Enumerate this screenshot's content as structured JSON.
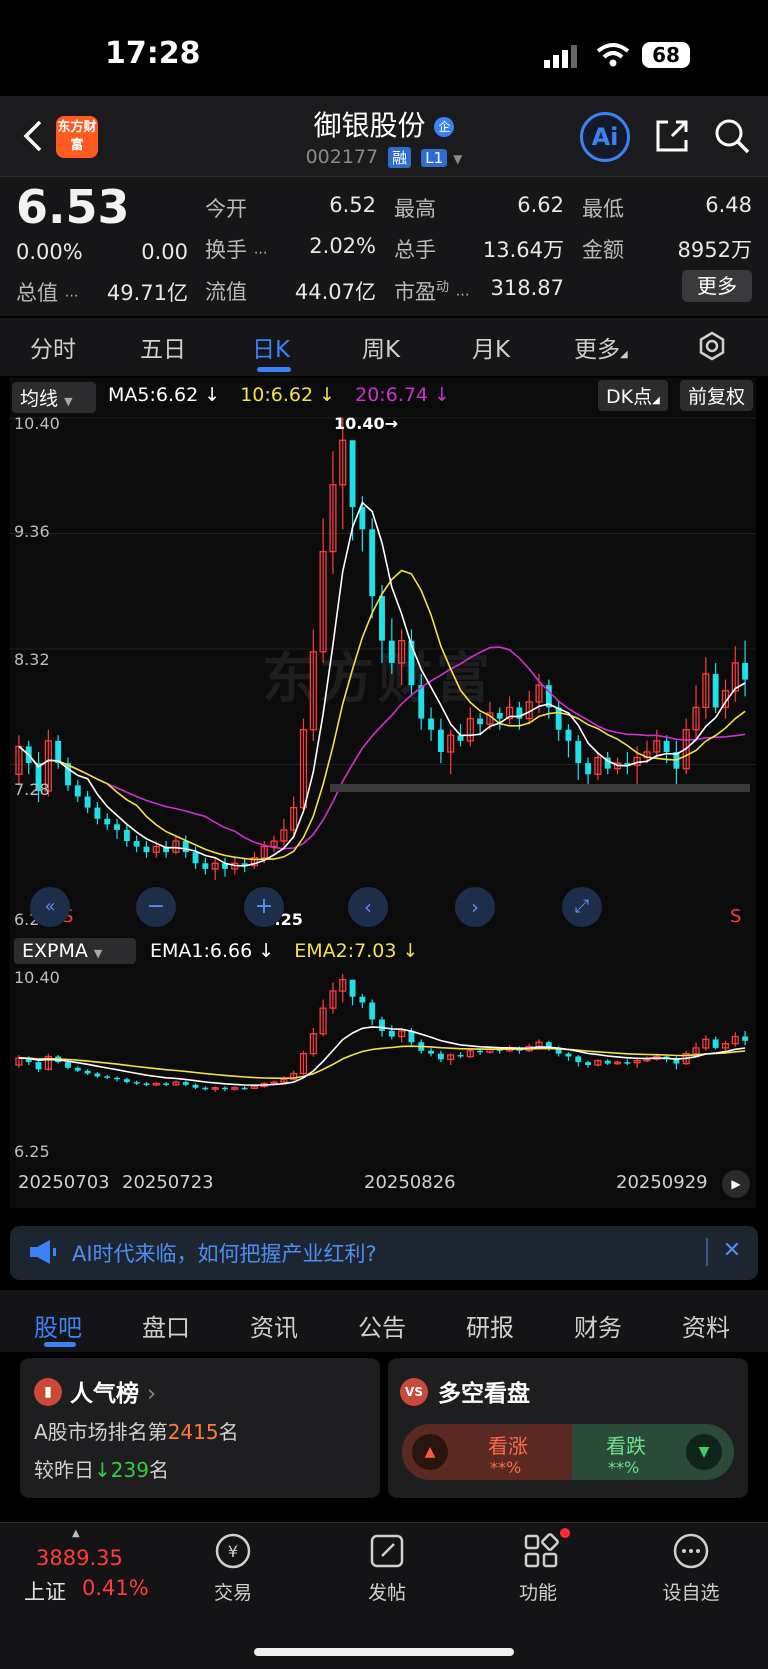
{
  "status_bar": {
    "time": "17:28",
    "battery": "68"
  },
  "header": {
    "logo_text": "东方财富",
    "stock_name": "御银股份",
    "enterprise_badge": "企",
    "stock_code": "002177",
    "tag_margin": "融",
    "tag_level": "L1",
    "ai_label": "Ai"
  },
  "quote": {
    "price": "6.53",
    "change_pct": "0.00%",
    "change_amt": "0.00",
    "market_cap_label": "总值",
    "market_cap": "49.71亿",
    "open_label": "今开",
    "open": "6.52",
    "high_label": "最高",
    "high": "6.62",
    "low_label": "最低",
    "low": "6.48",
    "turnover_label": "换手",
    "turnover": "2.02%",
    "volume_label": "总手",
    "volume": "13.64万",
    "amount_label": "金额",
    "amount": "8952万",
    "float_cap_label": "流值",
    "float_cap": "44.07亿",
    "pe_label": "市盈",
    "pe_sup": "动",
    "pe": "318.87",
    "more": "更多"
  },
  "period_tabs": [
    {
      "label": "分时"
    },
    {
      "label": "五日"
    },
    {
      "label": "日K",
      "active": true
    },
    {
      "label": "周K"
    },
    {
      "label": "月K"
    },
    {
      "label": "更多"
    }
  ],
  "chart": {
    "indicator_select": "均线",
    "ma5": "MA5:6.62",
    "ma10": "10:6.62",
    "ma20": "20:6.74",
    "dk_button": "DK点",
    "adjust_button": "前复权",
    "y_labels": [
      "10.40",
      "9.36",
      "8.32",
      "7.28",
      "6.25"
    ],
    "peak_label": "10.40",
    "low_label": "6.25",
    "s_marker": "S",
    "watermark": "东方财富",
    "sub_indicator_select": "EXPMA",
    "ema1": "EMA1:6.66",
    "ema2": "EMA2:7.03",
    "sub_y_top": "10.40",
    "sub_y_bottom": "6.25",
    "dates": [
      "20250703",
      "20250723",
      "20250826",
      "20250929"
    ],
    "colors": {
      "up": "#ff3b3b",
      "down": "#1fe0e8",
      "ma5": "#ffffff",
      "ma10": "#f2e14a",
      "ma20": "#d12fd1"
    }
  },
  "chart_data": {
    "type": "candlestick",
    "ylim": [
      6.25,
      10.4
    ],
    "annotations": {
      "max": 10.4,
      "min": 6.25
    },
    "x_ticks": [
      "20250703",
      "20250723",
      "20250826",
      "20250929"
    ],
    "candles": [
      [
        7.2,
        7.45,
        7.55,
        7.1
      ],
      [
        7.45,
        7.3,
        7.5,
        7.2
      ],
      [
        7.3,
        7.05,
        7.4,
        6.95
      ],
      [
        7.05,
        7.5,
        7.6,
        7.0
      ],
      [
        7.5,
        7.3,
        7.55,
        7.25
      ],
      [
        7.3,
        7.1,
        7.35,
        7.05
      ],
      [
        7.1,
        7.0,
        7.15,
        6.95
      ],
      [
        7.0,
        6.9,
        7.05,
        6.85
      ],
      [
        6.9,
        6.8,
        6.95,
        6.75
      ],
      [
        6.8,
        6.75,
        6.85,
        6.7
      ],
      [
        6.75,
        6.7,
        6.8,
        6.62
      ],
      [
        6.7,
        6.6,
        6.75,
        6.55
      ],
      [
        6.6,
        6.55,
        6.65,
        6.5
      ],
      [
        6.55,
        6.5,
        6.6,
        6.45
      ],
      [
        6.5,
        6.55,
        6.6,
        6.45
      ],
      [
        6.55,
        6.5,
        6.6,
        6.45
      ],
      [
        6.5,
        6.6,
        6.65,
        6.48
      ],
      [
        6.6,
        6.5,
        6.65,
        6.45
      ],
      [
        6.5,
        6.4,
        6.55,
        6.35
      ],
      [
        6.4,
        6.35,
        6.45,
        6.3
      ],
      [
        6.35,
        6.4,
        6.45,
        6.25
      ],
      [
        6.4,
        6.35,
        6.45,
        6.28
      ],
      [
        6.35,
        6.4,
        6.45,
        6.3
      ],
      [
        6.4,
        6.38,
        6.45,
        6.32
      ],
      [
        6.38,
        6.45,
        6.5,
        6.35
      ],
      [
        6.45,
        6.55,
        6.6,
        6.4
      ],
      [
        6.55,
        6.6,
        6.65,
        6.5
      ],
      [
        6.6,
        6.7,
        6.8,
        6.55
      ],
      [
        6.7,
        6.9,
        7.0,
        6.65
      ],
      [
        6.9,
        7.6,
        7.7,
        6.85
      ],
      [
        7.6,
        8.3,
        8.5,
        7.5
      ],
      [
        8.3,
        9.2,
        9.5,
        8.2
      ],
      [
        9.2,
        9.8,
        10.1,
        9.0
      ],
      [
        9.8,
        10.2,
        10.4,
        9.4
      ],
      [
        10.2,
        9.6,
        10.0,
        9.3
      ],
      [
        9.6,
        9.4,
        9.7,
        9.2
      ],
      [
        9.4,
        8.8,
        9.5,
        8.6
      ],
      [
        8.8,
        8.4,
        8.9,
        8.2
      ],
      [
        8.4,
        8.2,
        8.6,
        8.1
      ],
      [
        8.2,
        8.4,
        8.5,
        8.0
      ],
      [
        8.4,
        8.0,
        8.5,
        7.9
      ],
      [
        8.0,
        7.7,
        8.1,
        7.6
      ],
      [
        7.7,
        7.6,
        7.8,
        7.5
      ],
      [
        7.6,
        7.4,
        7.7,
        7.3
      ],
      [
        7.4,
        7.55,
        7.6,
        7.2
      ],
      [
        7.55,
        7.5,
        7.65,
        7.45
      ],
      [
        7.5,
        7.7,
        7.8,
        7.45
      ],
      [
        7.7,
        7.65,
        7.75,
        7.55
      ],
      [
        7.65,
        7.75,
        7.85,
        7.6
      ],
      [
        7.75,
        7.7,
        7.8,
        7.6
      ],
      [
        7.7,
        7.8,
        7.9,
        7.65
      ],
      [
        7.8,
        7.7,
        7.85,
        7.6
      ],
      [
        7.7,
        7.85,
        7.95,
        7.65
      ],
      [
        7.85,
        8.0,
        8.1,
        7.75
      ],
      [
        8.0,
        7.8,
        8.05,
        7.7
      ],
      [
        7.8,
        7.6,
        7.85,
        7.5
      ],
      [
        7.6,
        7.5,
        7.65,
        7.35
      ],
      [
        7.5,
        7.3,
        7.55,
        7.15
      ],
      [
        7.3,
        7.2,
        7.35,
        7.1
      ],
      [
        7.2,
        7.35,
        7.4,
        7.15
      ],
      [
        7.35,
        7.25,
        7.4,
        7.2
      ],
      [
        7.25,
        7.3,
        7.35,
        7.2
      ],
      [
        7.3,
        7.28,
        7.4,
        7.2
      ],
      [
        7.28,
        7.35,
        7.45,
        7.1
      ],
      [
        7.35,
        7.4,
        7.5,
        7.3
      ],
      [
        7.4,
        7.5,
        7.6,
        7.35
      ],
      [
        7.5,
        7.4,
        7.55,
        7.3
      ],
      [
        7.4,
        7.25,
        7.5,
        7.05
      ],
      [
        7.25,
        7.6,
        7.7,
        7.2
      ],
      [
        7.6,
        7.8,
        8.0,
        7.5
      ],
      [
        7.8,
        8.1,
        8.25,
        7.7
      ],
      [
        8.1,
        7.8,
        8.2,
        7.75
      ],
      [
        7.8,
        7.95,
        8.05,
        7.7
      ],
      [
        7.95,
        8.2,
        8.35,
        7.85
      ],
      [
        8.2,
        8.05,
        8.4,
        7.9
      ]
    ]
  },
  "banner": {
    "text": "AI时代来临，如何把握产业红利?"
  },
  "content_tabs": [
    {
      "label": "股吧",
      "active": true
    },
    {
      "label": "盘口"
    },
    {
      "label": "资讯"
    },
    {
      "label": "公告"
    },
    {
      "label": "研报"
    },
    {
      "label": "财务"
    },
    {
      "label": "资料"
    }
  ],
  "popularity_card": {
    "title": "人气榜",
    "rank_prefix": "A股市场排名第",
    "rank": "2415",
    "rank_suffix": "名",
    "compare_prefix": "较昨日",
    "compare_value": "239",
    "compare_suffix": "名"
  },
  "sentiment_card": {
    "title": "多空看盘",
    "bull_label": "看涨",
    "bull_value": "**%",
    "bear_label": "看跌",
    "bear_value": "**%"
  },
  "bottom_nav": {
    "index_value": "3889.35",
    "index_name": "上证",
    "index_change": "0.41%",
    "items": [
      {
        "label": "交易"
      },
      {
        "label": "发帖"
      },
      {
        "label": "功能"
      },
      {
        "label": "设自选"
      }
    ]
  }
}
